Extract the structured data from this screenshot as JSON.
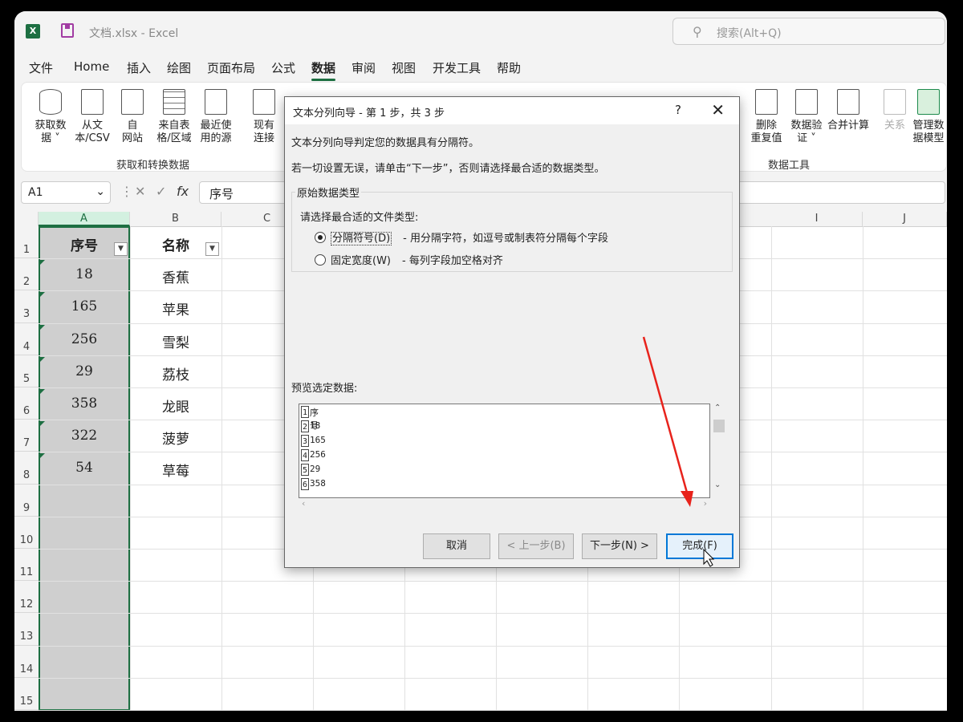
{
  "window": {
    "doc_title": "文档.xlsx  -  Excel",
    "search_placeholder": "搜索(Alt+Q)"
  },
  "menu": [
    "文件",
    "Home",
    "插入",
    "绘图",
    "页面布局",
    "公式",
    "数据",
    "审阅",
    "视图",
    "开发工具",
    "帮助"
  ],
  "ribbon": {
    "buttons_left": [
      {
        "label1": "获取数",
        "label2": "据 ˅"
      },
      {
        "label1": "从文",
        "label2": "本/CSV"
      },
      {
        "label1": "自",
        "label2": "网站"
      },
      {
        "label1": "来自表",
        "label2": "格/区域"
      },
      {
        "label1": "最近使",
        "label2": "用的源"
      },
      {
        "label1": "现有",
        "label2": "连接"
      }
    ],
    "buttons_right": [
      {
        "label1": "删除",
        "label2": "重复值"
      },
      {
        "label1": "数据验",
        "label2": "证 ˅"
      },
      {
        "label1": "合并计算",
        "label2": ""
      },
      {
        "label1": "关系",
        "label2": ""
      },
      {
        "label1": "管理数",
        "label2": "据模型"
      }
    ],
    "group_left": "获取和转换数据",
    "group_right": "数据工具"
  },
  "formula_bar": {
    "name_box": "A1",
    "fx": "fx",
    "content": "序号"
  },
  "sheet": {
    "columns": [
      "A",
      "B",
      "C",
      "I",
      "J"
    ],
    "rows": [
      "1",
      "2",
      "3",
      "4",
      "5",
      "6",
      "7",
      "8",
      "9",
      "10",
      "11",
      "12",
      "13",
      "14",
      "15"
    ],
    "colA": [
      "序号",
      "18",
      "165",
      "256",
      "29",
      "358",
      "322",
      "54"
    ],
    "colB": [
      "名称",
      "香蕉",
      "苹果",
      "雪梨",
      "荔枝",
      "龙眼",
      "菠萝",
      "草莓"
    ]
  },
  "dialog": {
    "title": "文本分列向导 - 第 1 步，共 3 步",
    "help": "?",
    "close": "✕",
    "line1": "文本分列向导判定您的数据具有分隔符。",
    "line2": "若一切设置无误，请单击“下一步”，否则请选择最合适的数据类型。",
    "group_title": "原始数据类型",
    "group_prompt": "请选择最合适的文件类型:",
    "option1_label": "分隔符号(D)",
    "option1_desc": "- 用分隔字符，如逗号或制表符分隔每个字段",
    "option2_label": "固定宽度(W)",
    "option2_desc": "- 每列字段加空格对齐",
    "preview_label": "预览选定数据:",
    "preview_rows": [
      {
        "n": "1",
        "v": "序号"
      },
      {
        "n": "2",
        "v": "18"
      },
      {
        "n": "3",
        "v": "165"
      },
      {
        "n": "4",
        "v": "256"
      },
      {
        "n": "5",
        "v": "29"
      },
      {
        "n": "6",
        "v": "358"
      }
    ],
    "buttons": {
      "cancel": "取消",
      "back": "< 上一步(B)",
      "next": "下一步(N) >",
      "finish": "完成(F)"
    }
  },
  "colors": {
    "accent": "#1d6f42",
    "annotation_arrow": "#e8231c"
  }
}
